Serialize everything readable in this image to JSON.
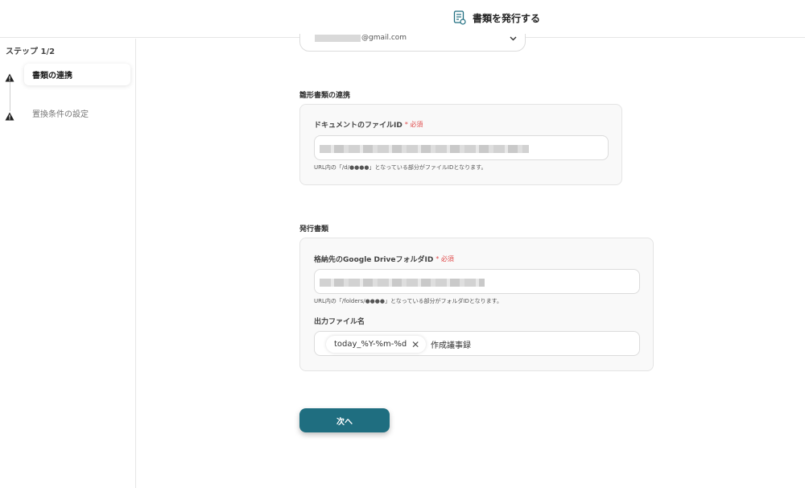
{
  "header": {
    "title": "書類を発行する",
    "icon": "document-icon"
  },
  "sidebar": {
    "step_count": "ステップ 1/2",
    "steps": [
      {
        "label": "書類の連携",
        "active": true,
        "status_icon": "warning-icon"
      },
      {
        "label": "置換条件の設定",
        "active": false,
        "status_icon": "warning-icon"
      }
    ]
  },
  "account": {
    "email_suffix": "@gmail.com"
  },
  "template_section": {
    "title": "雛形書類の連携",
    "file_id": {
      "label": "ドキュメントのファイルID",
      "required_mark": "* 必須",
      "help": "URL内の「/d/●●●●」となっている部分がファイルIDとなります。"
    }
  },
  "issue_section": {
    "title": "発行書類",
    "folder_id": {
      "label": "格納先のGoogle DriveフォルダID",
      "required_mark": "* 必須",
      "help": "URL内の「/folders/●●●●」となっている部分がフォルダIDとなります。"
    },
    "output_name": {
      "label": "出力ファイル名",
      "chip": "today_%Y-%m-%d",
      "suffix": "作成議事録"
    }
  },
  "next_button": {
    "label": "次へ"
  },
  "colors": {
    "accent": "#1f6e80",
    "required": "#e04b4b"
  }
}
